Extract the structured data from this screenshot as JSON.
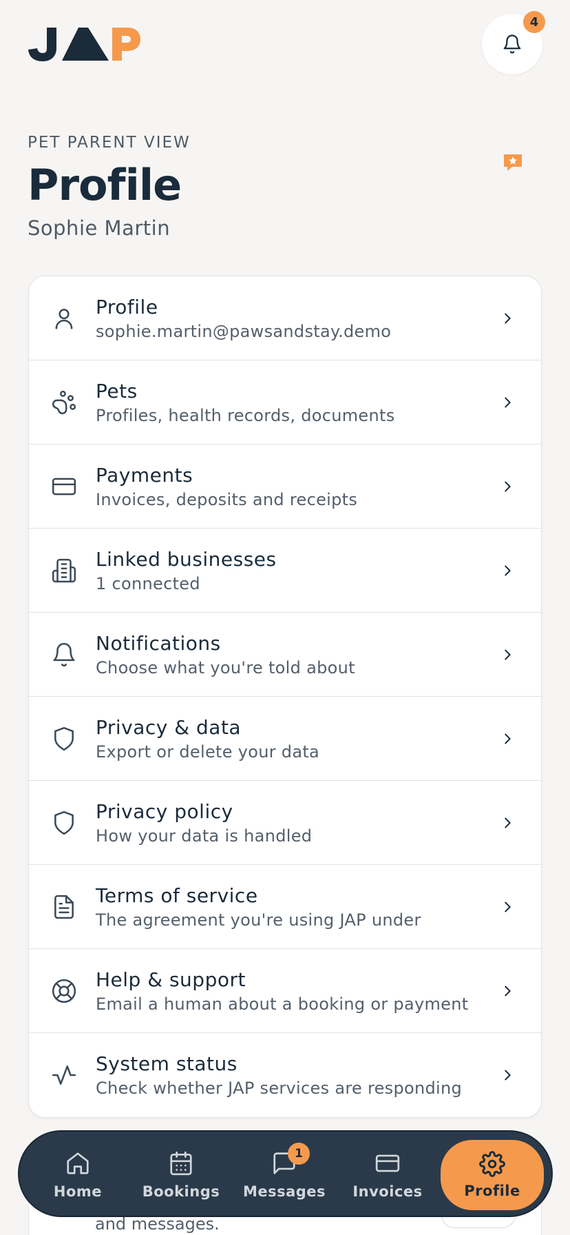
{
  "brand": {
    "logo_text": "JAP",
    "accent": "#f59a4d",
    "dark": "#1c2b39"
  },
  "header": {
    "notifications_count": "4"
  },
  "hero": {
    "eyebrow": "PET PARENT VIEW",
    "title": "Profile",
    "user_name": "Sophie Martin"
  },
  "menu": [
    {
      "icon": "user-icon",
      "title": "Profile",
      "subtitle": "sophie.martin@pawsandstay.demo"
    },
    {
      "icon": "paw-icon",
      "title": "Pets",
      "subtitle": "Profiles, health records, documents"
    },
    {
      "icon": "credit-card-icon",
      "title": "Payments",
      "subtitle": "Invoices, deposits and receipts"
    },
    {
      "icon": "building-icon",
      "title": "Linked businesses",
      "subtitle": "1 connected"
    },
    {
      "icon": "bell-icon",
      "title": "Notifications",
      "subtitle": "Choose what you're told about"
    },
    {
      "icon": "shield-icon",
      "title": "Privacy & data",
      "subtitle": "Export or delete your data"
    },
    {
      "icon": "shield-icon",
      "title": "Privacy policy",
      "subtitle": "How your data is handled"
    },
    {
      "icon": "document-icon",
      "title": "Terms of service",
      "subtitle": "The agreement you're using JAP under"
    },
    {
      "icon": "lifebuoy-icon",
      "title": "Help & support",
      "subtitle": "Email a human about a booking or payment"
    },
    {
      "icon": "activity-icon",
      "title": "System status",
      "subtitle": "Check whether JAP services are responding"
    }
  ],
  "behind_card": {
    "text": "and messages."
  },
  "tabbar": {
    "tabs": [
      {
        "icon": "home-icon",
        "label": "Home"
      },
      {
        "icon": "calendar-icon",
        "label": "Bookings"
      },
      {
        "icon": "message-icon",
        "label": "Messages",
        "badge": "1"
      },
      {
        "icon": "credit-card-icon",
        "label": "Invoices"
      },
      {
        "icon": "gear-icon",
        "label": "Profile",
        "active": true
      }
    ]
  }
}
